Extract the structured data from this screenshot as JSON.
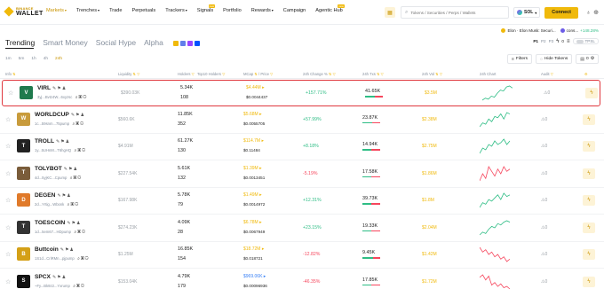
{
  "brand": {
    "line1": "BINANCE",
    "line2": "WALLET"
  },
  "nav": {
    "items": [
      {
        "label": "Markets",
        "active": true,
        "caret": true,
        "new": false
      },
      {
        "label": "Trenches",
        "active": false,
        "caret": true,
        "new": false
      },
      {
        "label": "Trade",
        "active": false,
        "caret": false,
        "new": false
      },
      {
        "label": "Perpetuals",
        "active": false,
        "caret": false,
        "new": false
      },
      {
        "label": "Trackers",
        "active": false,
        "caret": true,
        "new": false
      },
      {
        "label": "Signals",
        "active": false,
        "caret": false,
        "new": true
      },
      {
        "label": "Portfolio",
        "active": false,
        "caret": false,
        "new": false
      },
      {
        "label": "Rewards",
        "active": false,
        "caret": true,
        "new": false
      },
      {
        "label": "Campaign",
        "active": false,
        "caret": false,
        "new": false
      },
      {
        "label": "Agentic Hub",
        "active": false,
        "caret": false,
        "new": true
      }
    ],
    "new_label": "new",
    "search_placeholder": "Tokens / Securities / Perps / Wallets",
    "chain": "SOL",
    "connect_label": "Connect"
  },
  "ticker": [
    {
      "name": "Elon",
      "desc": "Elon Musk: Securi...",
      "change": ""
    },
    {
      "name": "",
      "desc": "cons...",
      "change": "+148.28%"
    }
  ],
  "tabs": [
    "Trending",
    "Smart Money",
    "Social Hype",
    "Alpha"
  ],
  "presets": {
    "p1": "P1",
    "p2": "P2",
    "p3": "P3",
    "value": "0",
    "toggle_label": "TPSL"
  },
  "timeframes": [
    "1m",
    "5m",
    "1h",
    "4h",
    "24h"
  ],
  "active_timeframe": "24h",
  "tools": {
    "filters": "Filters",
    "hide_tokens": "Hide Tokens",
    "count": "0"
  },
  "columns": {
    "info": "Info",
    "liquidity": "Liquidity",
    "holders": "Holders",
    "top10": "Top10 Holders",
    "mcap": "MCap",
    "price": "Price",
    "change": "24h Change %",
    "txs": "24h Txs",
    "volume": "24h Vol",
    "chart": "24h Chart",
    "audit": "Audit"
  },
  "tokens": [
    {
      "name": "VIRL",
      "addr": "3yj...Bvtz4W...6xyzsc",
      "liquidity": "$390.03K",
      "holders": "5.34K",
      "holders2": "108",
      "top10": "",
      "mcap": "$4.44M",
      "mcap_color": "o",
      "price": "$0.0044437",
      "change": "+157.71%",
      "dir": "up",
      "txs": "41.65K",
      "buy_ratio": 0.55,
      "volume": "$3.5M",
      "audit": "0",
      "avatar_color": "#1f7a4d",
      "avatar_text": "V",
      "spark": [
        2,
        4,
        3,
        6,
        5,
        9,
        12,
        11,
        15,
        16,
        14
      ]
    },
    {
      "name": "WORLDCUP",
      "addr": "1c...59snm...75pump",
      "liquidity": "$560.6K",
      "holders": "11.85K",
      "holders2": "352",
      "top10": "",
      "mcap": "$5.68M",
      "mcap_color": "o",
      "price": "$0.0055705",
      "change": "+57.99%",
      "dir": "up",
      "txs": "23.87K",
      "buy_ratio": 0.55,
      "volume": "$2.38M",
      "audit": "0",
      "avatar_color": "#c89b3c",
      "avatar_text": "W",
      "spark": [
        3,
        6,
        5,
        9,
        7,
        11,
        10,
        13,
        9,
        14,
        13
      ]
    },
    {
      "name": "TROLL",
      "addr": "1y...5UHnM...T6hgHQ",
      "liquidity": "$4.91M",
      "holders": "61.27K",
      "holders2": "130",
      "top10": "",
      "mcap": "$114.7M",
      "mcap_color": "o",
      "price": "$0.11484",
      "change": "+8.18%",
      "dir": "up",
      "txs": "14.94K",
      "buy_ratio": 0.5,
      "volume": "$2.75M",
      "audit": "0",
      "avatar_color": "#222222",
      "avatar_text": "T",
      "spark": [
        5,
        8,
        7,
        10,
        9,
        12,
        10,
        11,
        13,
        10,
        12
      ]
    },
    {
      "name": "TOLYBOT",
      "addr": "4d...5yjKC...Cpump",
      "liquidity": "$227.54K",
      "holders": "5.61K",
      "holders2": "132",
      "top10": "",
      "mcap": "$1.39M",
      "mcap_color": "o",
      "price": "$0.0013451",
      "change": "-5.19%",
      "dir": "down",
      "txs": "17.58K",
      "buy_ratio": 0.5,
      "volume": "$1.86M",
      "audit": "0",
      "avatar_color": "#7a5c3a",
      "avatar_text": "T",
      "spark": [
        6,
        9,
        7,
        12,
        10,
        8,
        11,
        9,
        12,
        10,
        11
      ]
    },
    {
      "name": "DEGEN",
      "addr": "2d...Yrtig...Wbonk",
      "liquidity": "$167.98K",
      "holders": "5.78K",
      "holders2": "79",
      "top10": "",
      "mcap": "$1.49M",
      "mcap_color": "o",
      "price": "$0.0014972",
      "change": "+12.31%",
      "dir": "up",
      "txs": "39.73K",
      "buy_ratio": 0.5,
      "volume": "$1.8M",
      "audit": "0",
      "avatar_color": "#e07a2a",
      "avatar_text": "D",
      "spark": [
        4,
        7,
        6,
        9,
        8,
        10,
        12,
        9,
        13,
        11,
        12
      ]
    },
    {
      "name": "TOESCOIN",
      "addr": "1d...5em67...HDpump",
      "liquidity": "$274.23K",
      "holders": "4.09K",
      "holders2": "28",
      "top10": "",
      "mcap": "$6.78M",
      "mcap_color": "o",
      "price": "$0.0067949",
      "change": "+23.15%",
      "dir": "up",
      "txs": "19.33K",
      "buy_ratio": 0.5,
      "volume": "$2.04M",
      "audit": "0",
      "avatar_color": "#333333",
      "avatar_text": "T",
      "spark": [
        3,
        5,
        4,
        7,
        9,
        8,
        11,
        10,
        12,
        13,
        12
      ]
    },
    {
      "name": "Buttcoin",
      "addr": "1S1d...CriRMn...pjpump",
      "liquidity": "$1.25M",
      "holders": "16.85K",
      "holders2": "154",
      "top10": "",
      "mcap": "$18.72M",
      "mcap_color": "o",
      "price": "$0.018721",
      "change": "-12.82%",
      "dir": "down",
      "txs": "9.45K",
      "buy_ratio": 0.6,
      "volume": "$1.42M",
      "audit": "0",
      "avatar_color": "#d4a017",
      "avatar_text": "B",
      "spark": [
        10,
        8,
        9,
        7,
        8,
        6,
        7,
        5,
        6,
        4,
        5
      ]
    },
    {
      "name": "SPCX",
      "addr": "~Fy...Bk9z2...Yxrump",
      "liquidity": "$153.04K",
      "holders": "4.79K",
      "holders2": "179",
      "top10": "",
      "mcap": "$969.06K",
      "mcap_color": "b",
      "price": "$0.00096936",
      "change": "-46.35%",
      "dir": "down",
      "txs": "17.85K",
      "buy_ratio": 0.5,
      "volume": "$1.72M",
      "audit": "0",
      "avatar_color": "#111111",
      "avatar_text": "S",
      "spark": [
        12,
        14,
        10,
        13,
        6,
        8,
        5,
        7,
        4,
        5,
        3
      ]
    }
  ],
  "colors": {
    "accent": "#f0b90b",
    "up": "#2ebd85",
    "down": "#f6465d",
    "select": "#e0383e"
  }
}
